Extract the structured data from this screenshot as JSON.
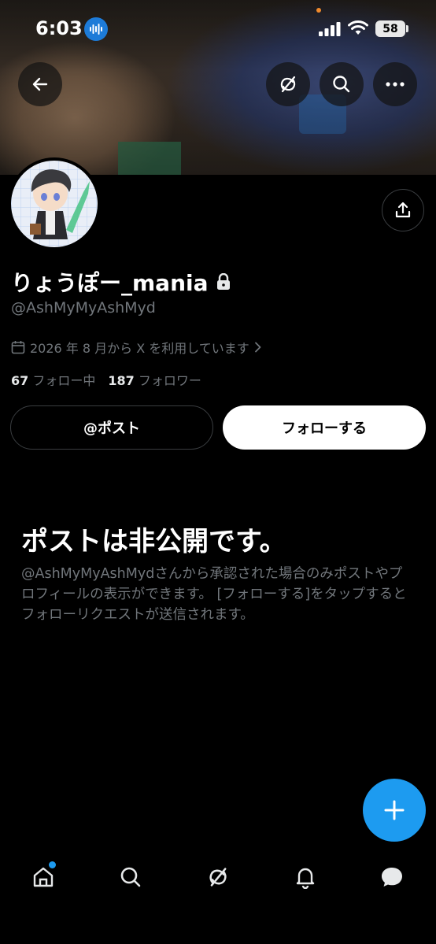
{
  "status_bar": {
    "time": "6:03",
    "battery": "58"
  },
  "profile": {
    "display_name": "りょうぽー_mania",
    "handle": "@AshMyMyAshMyd",
    "joined": "2026 年 8 月から X を利用しています",
    "following_count": "67",
    "following_label": "フォロー中",
    "followers_count": "187",
    "followers_label": "フォロワー"
  },
  "actions": {
    "post_label": "@ポスト",
    "follow_label": "フォローする"
  },
  "private_notice": {
    "title": "ポストは非公開です。",
    "body": "@AshMyMyAshMydさんから承認された場合のみポストやプロフィールの表示ができます。 [フォローする]をタップするとフォローリクエストが送信されます。"
  },
  "colors": {
    "accent": "#1d9bf0",
    "background": "#000000",
    "muted_text": "#71767b"
  },
  "icons": [
    "back-arrow-icon",
    "grok-icon",
    "search-icon",
    "more-icon",
    "share-icon",
    "calendar-icon",
    "chevron-right-icon",
    "lock-icon",
    "plus-icon",
    "home-icon",
    "notifications-icon",
    "messages-icon"
  ]
}
